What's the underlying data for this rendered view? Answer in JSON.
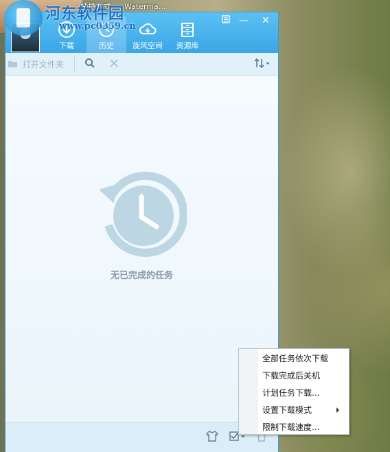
{
  "taskbar": {
    "items": [
      "- 快捷方式",
      "Waterma..."
    ]
  },
  "watermark": {
    "title": "河东软件园",
    "url": "www.pc0359.cn"
  },
  "nav": {
    "tabs": [
      {
        "label": "下载",
        "icon": "download-icon",
        "active": false
      },
      {
        "label": "历史",
        "icon": "history-icon",
        "active": true
      },
      {
        "label": "旋风空间",
        "icon": "cloud-icon",
        "active": false
      },
      {
        "label": "资源库",
        "icon": "library-icon",
        "active": false
      }
    ]
  },
  "window_controls": {
    "menu_icon": "menu-icon",
    "minimize": "—",
    "close": "✕"
  },
  "toolbar": {
    "open_folder_label": "打开文件夹",
    "search_icon": "search-icon",
    "clear_icon": "close-icon",
    "sort_icon": "sort-icon"
  },
  "content": {
    "empty_message": "无已完成的任务"
  },
  "context_menu": {
    "items": [
      {
        "label": "全部任务依次下载",
        "submenu": false
      },
      {
        "label": "下载完成后关机",
        "submenu": false
      },
      {
        "label": "计划任务下载...",
        "submenu": false
      },
      {
        "label": "设置下载模式",
        "submenu": true
      },
      {
        "label": "限制下载速度...",
        "submenu": false
      }
    ]
  },
  "colors": {
    "accent": "#3aa6e6",
    "empty_icon": "#bcd6e4"
  }
}
